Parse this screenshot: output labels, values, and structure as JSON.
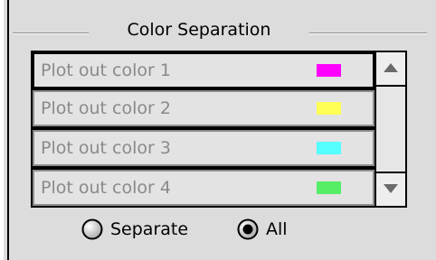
{
  "group": {
    "title": "Color Separation"
  },
  "list": {
    "items": [
      {
        "label": "Plot out color 1",
        "swatch_color": "#ff00ff",
        "selected": true
      },
      {
        "label": "Plot out color 2",
        "swatch_color": "#ffff55",
        "selected": false
      },
      {
        "label": "Plot out color 3",
        "swatch_color": "#55ffff",
        "selected": false
      },
      {
        "label": "Plot out color 4",
        "swatch_color": "#55ee66",
        "selected": false
      }
    ],
    "scroll_up_icon": "up-triangle",
    "scroll_down_icon": "down-triangle"
  },
  "options": {
    "separate_label": "Separate",
    "all_label": "All",
    "selected": "All"
  }
}
